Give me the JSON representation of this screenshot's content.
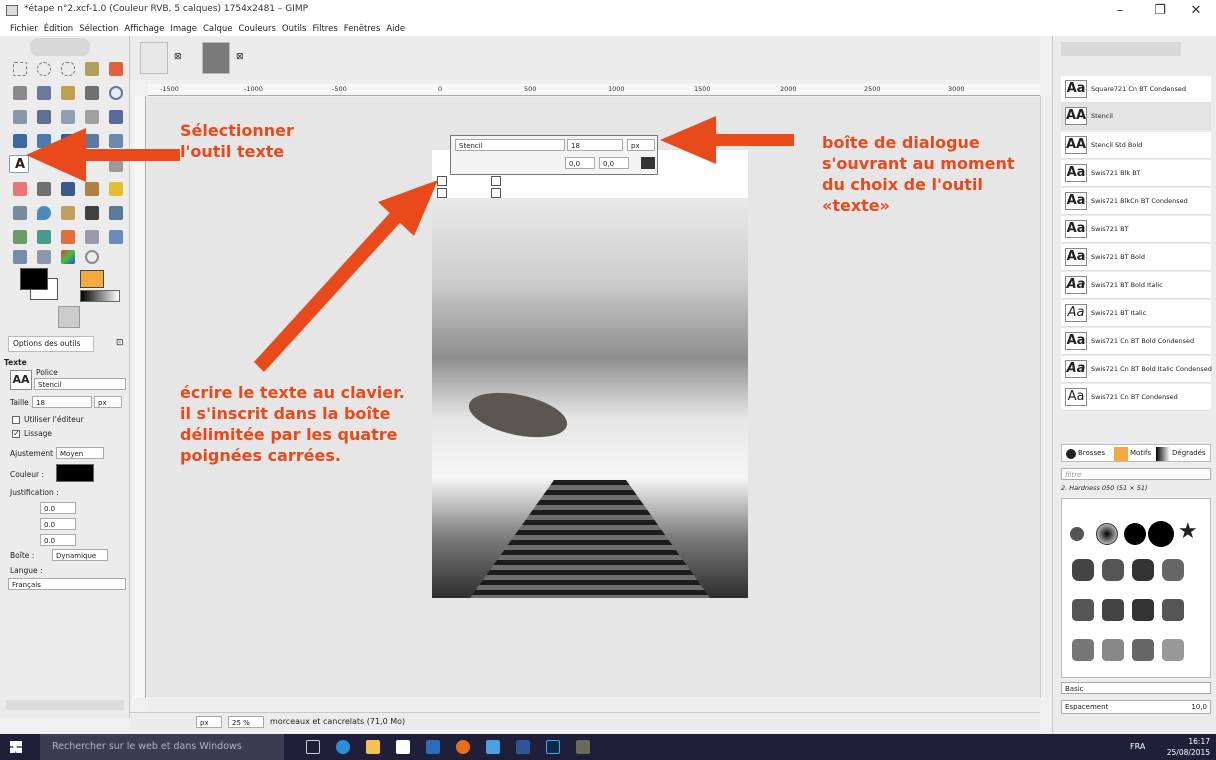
{
  "window": {
    "title": "*étape n°2.xcf-1.0 (Couleur RVB, 5 calques) 1754x2481 – GIMP"
  },
  "menu": [
    "Fichier",
    "Édition",
    "Sélection",
    "Affichage",
    "Image",
    "Calque",
    "Couleurs",
    "Outils",
    "Filtres",
    "Fenêtres",
    "Aide"
  ],
  "ruler_ticks": [
    "-1500",
    "-1000",
    "-500",
    "0",
    "500",
    "1000",
    "1500",
    "2000",
    "2500",
    "3000"
  ],
  "tool_options": {
    "tab": "Options des outils",
    "section": "Texte",
    "font_label": "Police",
    "font_value": "Stencil",
    "size_label": "Taille :",
    "size_value": "18",
    "size_unit": "px",
    "use_editor": "Utiliser l'éditeur",
    "antialias": "Lissage",
    "hinting_label": "Ajustement :",
    "hinting_value": "Moyen",
    "color_label": "Couleur :",
    "justify_label": "Justification :",
    "indent_value": "0.0",
    "line_spacing_value": "0.0",
    "letter_spacing_value": "0.0",
    "box_label": "Boîte :",
    "box_value": "Dynamique",
    "language_label": "Langue :",
    "language_value": "Français"
  },
  "text_dialog": {
    "font": "Stencil",
    "size": "18",
    "unit": "px",
    "baseline": "0,0",
    "kerning": "0,0"
  },
  "status": {
    "unit": "px",
    "zoom": "25 %",
    "info": "morceaux et cancrelats (71,0 Mo)"
  },
  "annotations": {
    "select_tool": [
      "Sélectionner",
      "l'outil texte"
    ],
    "dialog": [
      "boîte de dialogue",
      "s'ouvrant au moment",
      "du choix de l'outil",
      "«texte»"
    ],
    "write": [
      "écrire le texte au clavier.",
      "il s'inscrit dans la boîte",
      "délimitée par les quatre",
      "poignées carrées."
    ]
  },
  "fonts": [
    "Square721 Cn BT Condensed",
    "Stencil",
    "Stencil Std Bold",
    "Swis721 Blk BT",
    "Swis721 BlkCn BT Condensed",
    "Swis721 BT",
    "Swis721 BT Bold",
    "Swis721 BT Bold Italic",
    "Swis721 BT Italic",
    "Swis721 Cn BT Bold Condensed",
    "Swis721 Cn BT Bold Italic Condensed",
    "Swis721 Cn BT Condensed"
  ],
  "font_preview_glyph": "Aa",
  "brush_panel": {
    "tabs": [
      "Brosses",
      "Motifs",
      "Dégradés"
    ],
    "filter_placeholder": "filtre",
    "current_brush": "2. Hardness 050 (51 × 51)",
    "preset": "Basic",
    "spacing_label": "Espacement",
    "spacing_value": "10,0"
  },
  "taskbar": {
    "search_placeholder": "Rechercher sur le web et dans Windows",
    "lang": "FRA",
    "time": "16:17",
    "date": "25/08/2015"
  }
}
